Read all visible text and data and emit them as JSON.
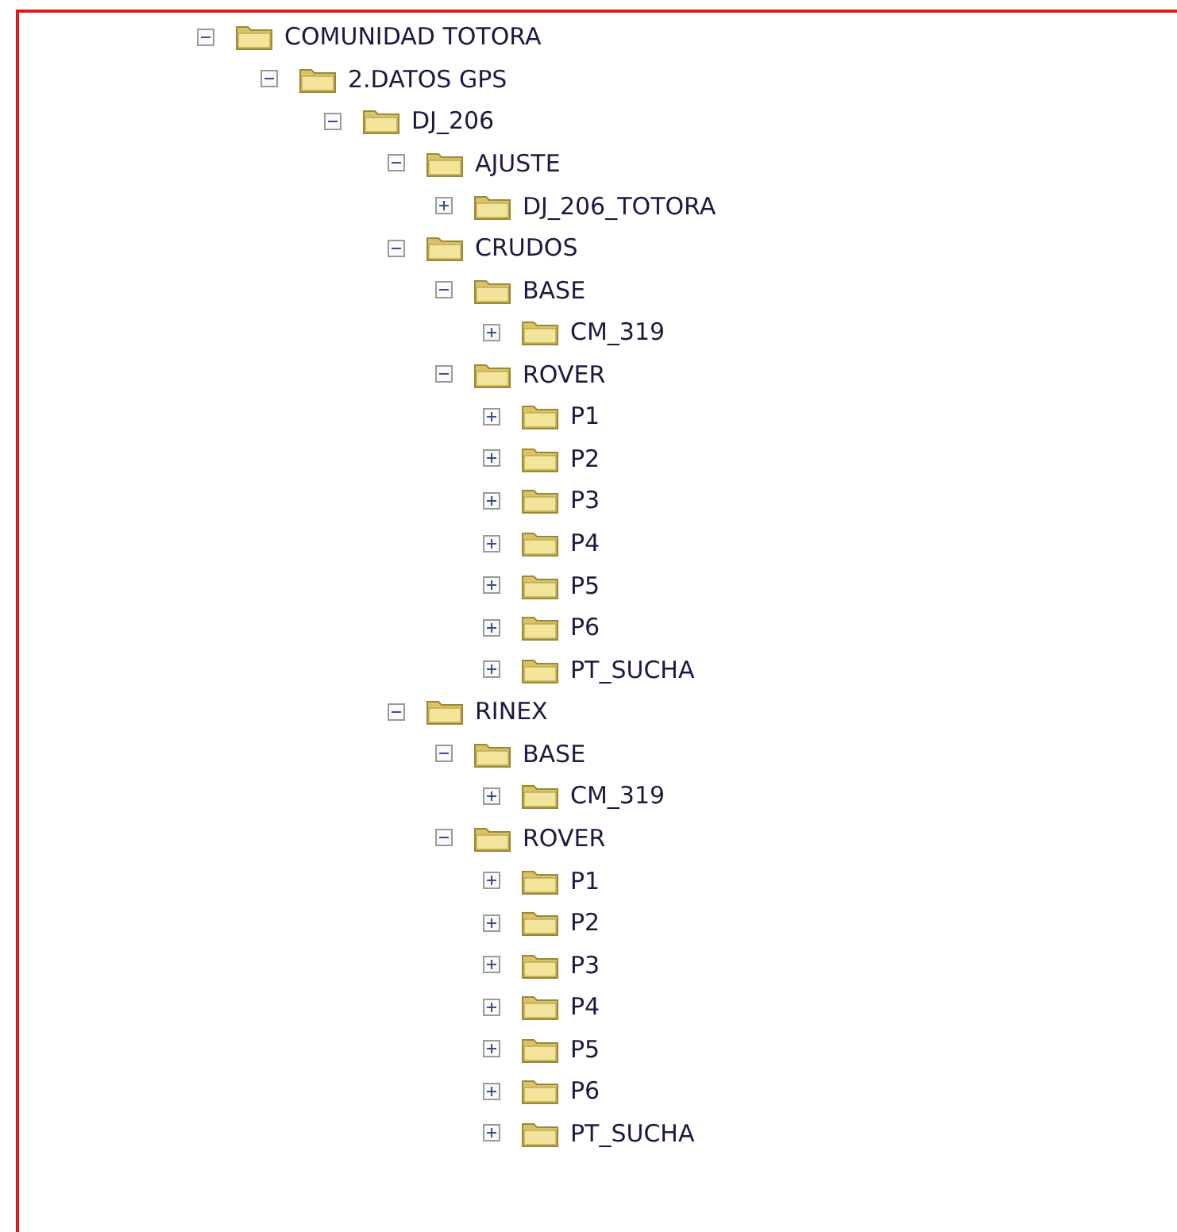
{
  "tree": [
    {
      "label": "COMUNIDAD TOTORA",
      "expanded": true,
      "children": [
        {
          "label": "2.DATOS GPS",
          "expanded": true,
          "children": [
            {
              "label": "DJ_206",
              "expanded": true,
              "children": [
                {
                  "label": "AJUSTE",
                  "expanded": true,
                  "children": [
                    {
                      "label": "DJ_206_TOTORA",
                      "expanded": false
                    }
                  ]
                },
                {
                  "label": "CRUDOS",
                  "expanded": true,
                  "children": [
                    {
                      "label": "BASE",
                      "expanded": true,
                      "children": [
                        {
                          "label": "CM_319",
                          "expanded": false
                        }
                      ]
                    },
                    {
                      "label": "ROVER",
                      "expanded": true,
                      "children": [
                        {
                          "label": "P1",
                          "expanded": false
                        },
                        {
                          "label": "P2",
                          "expanded": false
                        },
                        {
                          "label": "P3",
                          "expanded": false
                        },
                        {
                          "label": "P4",
                          "expanded": false
                        },
                        {
                          "label": "P5",
                          "expanded": false
                        },
                        {
                          "label": "P6",
                          "expanded": false
                        },
                        {
                          "label": "PT_SUCHA",
                          "expanded": false
                        }
                      ]
                    }
                  ]
                },
                {
                  "label": "RINEX",
                  "expanded": true,
                  "children": [
                    {
                      "label": "BASE",
                      "expanded": true,
                      "children": [
                        {
                          "label": "CM_319",
                          "expanded": false
                        }
                      ]
                    },
                    {
                      "label": "ROVER",
                      "expanded": true,
                      "children": [
                        {
                          "label": "P1",
                          "expanded": false
                        },
                        {
                          "label": "P2",
                          "expanded": false
                        },
                        {
                          "label": "P3",
                          "expanded": false
                        },
                        {
                          "label": "P4",
                          "expanded": false
                        },
                        {
                          "label": "P5",
                          "expanded": false
                        },
                        {
                          "label": "P6",
                          "expanded": false
                        },
                        {
                          "label": "PT_SUCHA",
                          "expanded": false
                        }
                      ]
                    }
                  ]
                }
              ]
            }
          ]
        }
      ]
    }
  ]
}
